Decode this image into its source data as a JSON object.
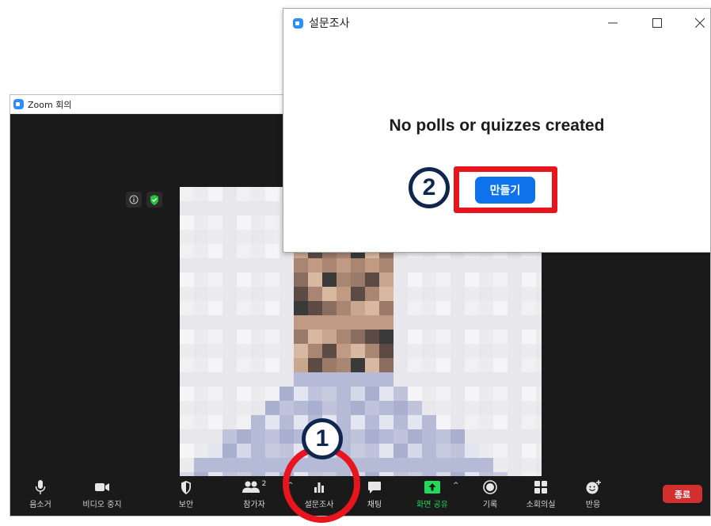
{
  "zoom_window": {
    "title": "Zoom 회의"
  },
  "poll_dialog": {
    "title": "설문조사",
    "empty_message": "No polls or quizzes created",
    "create_button": "만들기"
  },
  "toolbar": {
    "mute": "음소거",
    "stop_video": "비디오 중지",
    "security": "보안",
    "participants": "참가자",
    "participants_count": "2",
    "polls": "설문조사",
    "chat": "채팅",
    "share_screen": "화면 공유",
    "record": "기록",
    "breakout_rooms": "소회의실",
    "reactions": "반응",
    "end": "종료"
  },
  "annotations": {
    "step1": "1",
    "step2": "2"
  },
  "colors": {
    "zoom_blue": "#2d8cff",
    "create_blue": "#0e72ed",
    "highlight_red": "#e8141e",
    "share_green": "#23d959",
    "end_red": "#d32f2f"
  }
}
